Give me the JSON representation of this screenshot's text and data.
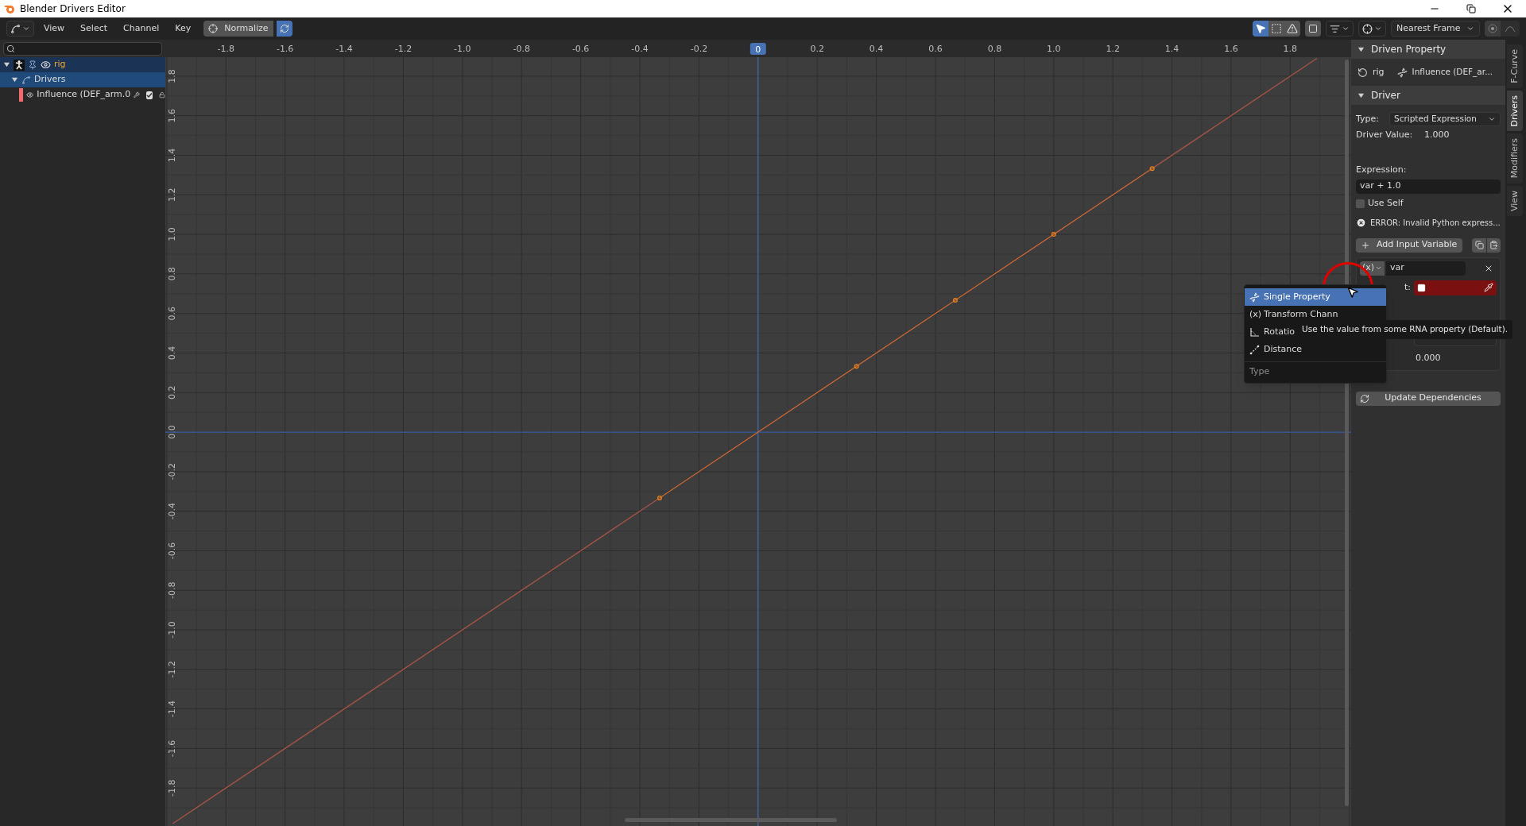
{
  "window": {
    "title": "Blender Drivers Editor"
  },
  "header": {
    "menus": [
      "View",
      "Select",
      "Channel",
      "Key"
    ],
    "normalize": {
      "label": "Normalize",
      "selected": false
    },
    "auto_normalize": {
      "selected": true
    },
    "tools": [
      {
        "kind": "select",
        "selected": true
      },
      {
        "kind": "box",
        "selected": false
      },
      {
        "kind": "warning",
        "selected": false
      }
    ],
    "snapping": "Nearest Frame",
    "proportional": {
      "selected": false
    }
  },
  "channels": [
    {
      "label": "rig",
      "kind": "object",
      "selected": false,
      "expanded": true,
      "children": [
        {
          "label": "Drivers",
          "kind": "group",
          "selected": true,
          "expanded": true,
          "children": [
            {
              "label": "Influence (DEF_arm.0",
              "kind": "fcurve",
              "selected": false,
              "color": "#f06a6a",
              "checked": true
            }
          ]
        }
      ]
    }
  ],
  "graph": {
    "playhead": {
      "label": "0"
    },
    "chart_data": {
      "type": "line",
      "grid": true,
      "x": [
        -1.98,
        -0.333,
        0.333,
        0.667,
        1.0,
        1.333,
        1.89
      ],
      "series": [
        {
          "color": "#a35446",
          "values": [
            -1.98,
            -0.333,
            0.333,
            0.667,
            1.0,
            1.333,
            1.89
          ]
        },
        {
          "color": "#e8801a",
          "marker": true,
          "values": [
            null,
            -0.333,
            0.333,
            0.667,
            1.0,
            1.333,
            null
          ]
        }
      ],
      "xlim": [
        -2.005,
        2.006
      ],
      "ylim": [
        -1.992,
        1.896
      ],
      "ref_lines": [
        {
          "axis": "x",
          "value": 0,
          "color": "#4772b3"
        },
        {
          "axis": "y",
          "value": 0,
          "color": "#3a62a6"
        }
      ],
      "xticks": [
        {
          "value": -1.8,
          "label": "-1.8"
        },
        {
          "value": -1.6,
          "label": "-1.6"
        },
        {
          "value": -1.4,
          "label": "-1.4"
        },
        {
          "value": -1.2,
          "label": "-1.2"
        },
        {
          "value": -1.0,
          "label": "-1.0"
        },
        {
          "value": -0.8,
          "label": "-0.8"
        },
        {
          "value": -0.6,
          "label": "-0.6"
        },
        {
          "value": -0.4,
          "label": "-0.4"
        },
        {
          "value": -0.2,
          "label": "-0.2"
        },
        {
          "value": 0.2,
          "label": "0.2"
        },
        {
          "value": 0.4,
          "label": "0.4"
        },
        {
          "value": 0.6,
          "label": "0.6"
        },
        {
          "value": 0.8,
          "label": "0.8"
        },
        {
          "value": 1.0,
          "label": "1.0"
        },
        {
          "value": 1.2,
          "label": "1.2"
        },
        {
          "value": 1.4,
          "label": "1.4"
        },
        {
          "value": 1.6,
          "label": "1.6"
        },
        {
          "value": 1.8,
          "label": "1.8"
        }
      ],
      "yticks": [
        {
          "value": 1.8,
          "label": "1.8"
        },
        {
          "value": 1.6,
          "label": "1.6"
        },
        {
          "value": 1.4,
          "label": "1.4"
        },
        {
          "value": 1.2,
          "label": "1.2"
        },
        {
          "value": 1.0,
          "label": "1.0"
        },
        {
          "value": 0.8,
          "label": "0.8"
        },
        {
          "value": 0.6,
          "label": "0.6"
        },
        {
          "value": 0.4,
          "label": "0.4"
        },
        {
          "value": 0.2,
          "label": "0.2"
        },
        {
          "value": 0.0,
          "label": "0.0"
        },
        {
          "value": -0.2,
          "label": "-0.2"
        },
        {
          "value": -0.4,
          "label": "-0.4"
        },
        {
          "value": -0.6,
          "label": "-0.6"
        },
        {
          "value": -0.8,
          "label": "-0.8"
        },
        {
          "value": -1.0,
          "label": "-1.0"
        },
        {
          "value": -1.2,
          "label": "-1.2"
        },
        {
          "value": -1.4,
          "label": "-1.4"
        },
        {
          "value": -1.6,
          "label": "-1.6"
        },
        {
          "value": -1.8,
          "label": "-1.8"
        }
      ]
    }
  },
  "sidebar": {
    "tabs": [
      {
        "label": "F-Curve",
        "selected": false
      },
      {
        "label": "Drivers",
        "selected": true
      },
      {
        "label": "Modifiers",
        "selected": false
      },
      {
        "label": "View",
        "selected": false
      }
    ],
    "driven_property": {
      "title": "Driven Property",
      "expanded": true,
      "object": "rig",
      "property": "Influence (DEF_ar..."
    },
    "driver": {
      "title": "Driver",
      "expanded": true,
      "type_label": "Type:",
      "type": "Scripted Expression",
      "value_label": "Driver Value:",
      "value": "1.000",
      "expression_label": "Expression:",
      "expression": "var + 1.0",
      "use_self": {
        "label": "Use Self",
        "checked": false
      },
      "error": "ERROR: Invalid Python express...",
      "add_variable": "Add Input Variable",
      "variable": {
        "type_symbol": "(x)",
        "name": "var",
        "object_label": "t:",
        "value": "0.000"
      },
      "update": "Update Dependencies"
    }
  },
  "type_menu": {
    "items": [
      {
        "label": "Single Property",
        "kind": "single",
        "selected": true
      },
      {
        "label": "Transform Chann",
        "kind": "transform",
        "symbol": "(x)",
        "selected": false
      },
      {
        "label": "Rotatio",
        "kind": "rotation",
        "selected": false
      },
      {
        "label": "Distance",
        "kind": "distance",
        "selected": false
      }
    ],
    "title": "Type"
  },
  "tooltip": "Use the value from some RNA property (Default)."
}
